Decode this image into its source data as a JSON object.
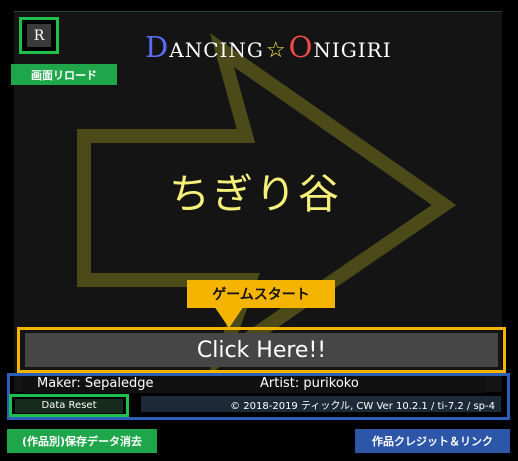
{
  "title": {
    "first_initial": "D",
    "first_rest": "ANCING",
    "star": "☆",
    "second_initial": "O",
    "second_rest": "NIGIRI"
  },
  "reload": {
    "key_label": "R",
    "annotation": "画面リロード"
  },
  "song": {
    "title": "ちぎり谷"
  },
  "start": {
    "annotation": "ゲームスタート",
    "button_label": "Click Here!!"
  },
  "credits": {
    "maker": "Maker: Sepaledge",
    "artist": "Artist: purikoko",
    "version": "© 2018-2019 ティックル, CW Ver 10.2.1 / ti-7.2 / sp-4",
    "annotation": "作品クレジット＆リンク"
  },
  "reset": {
    "button_label": "Data Reset",
    "annotation": "(作品別)保存データ消去"
  },
  "colors": {
    "annotation_green": "#1fa64a",
    "annotation_blue": "#2d56a8",
    "annotation_orange": "#f5b400",
    "title_d": "#5b6cf4",
    "title_o": "#f2494b",
    "song_title": "#f6f07a",
    "arrow": "#4c4a19"
  },
  "icons": {
    "background": "right-arrow-icon",
    "title_star": "star-icon"
  }
}
